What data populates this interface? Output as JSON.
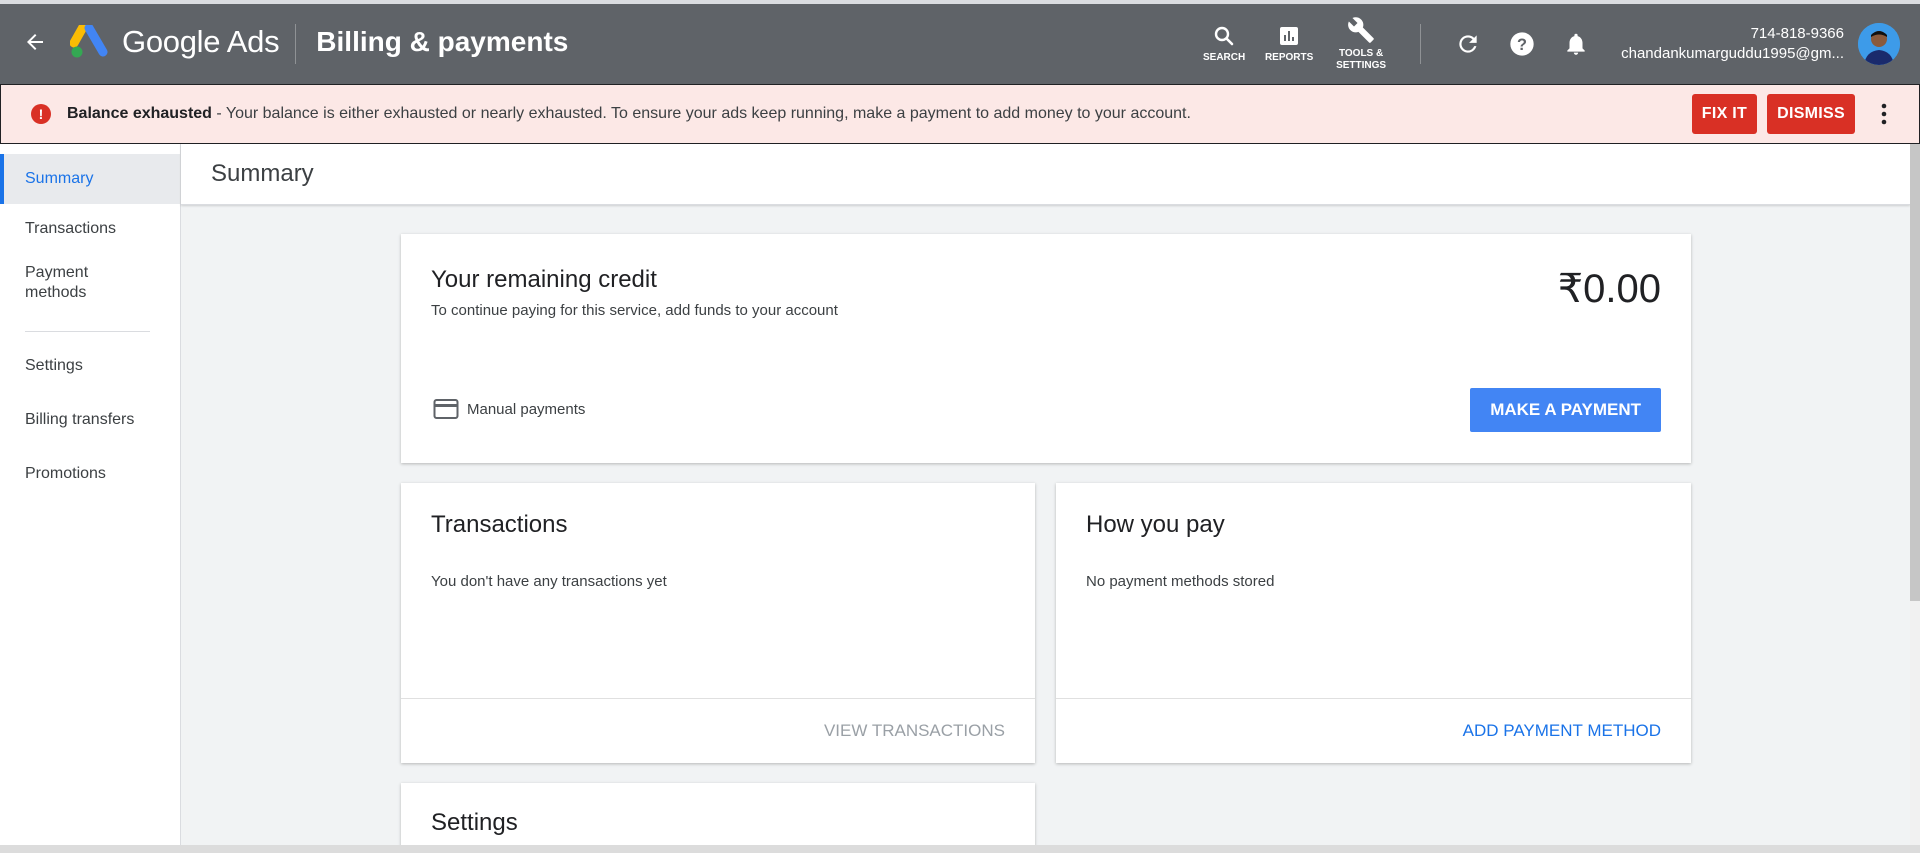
{
  "header": {
    "brand": "Google Ads",
    "page_title": "Billing & payments",
    "tools": {
      "search_label": "SEARCH",
      "reports_label": "REPORTS",
      "tools_label_line1": "TOOLS &",
      "tools_label_line2": "SETTINGS"
    },
    "account": {
      "phone": "714-818-9366",
      "email": "chandankumarguddu1995@gm..."
    }
  },
  "alert": {
    "title": "Balance exhausted",
    "message": " - Your balance is either exhausted or nearly exhausted. To ensure your ads keep running, make a payment to add money to your account.",
    "fix_label": "FIX IT",
    "dismiss_label": "DISMISS",
    "icon_glyph": "!"
  },
  "sidebar": {
    "items": [
      {
        "label": "Summary"
      },
      {
        "label": "Transactions"
      },
      {
        "label": "Payment methods"
      },
      {
        "label": "Settings"
      },
      {
        "label": "Billing transfers"
      },
      {
        "label": "Promotions"
      }
    ]
  },
  "main": {
    "title": "Summary",
    "credit": {
      "title": "Your remaining credit",
      "subtitle": "To continue paying for this service, add funds to your account",
      "amount": "₹0.00",
      "manual_label": "Manual payments",
      "button_label": "MAKE A PAYMENT"
    },
    "transactions": {
      "title": "Transactions",
      "message": "You don't have any transactions yet",
      "link_label": "VIEW TRANSACTIONS"
    },
    "how_you_pay": {
      "title": "How you pay",
      "message": "No payment methods stored",
      "link_label": "ADD PAYMENT METHOD"
    },
    "settings": {
      "title": "Settings"
    }
  },
  "colors": {
    "topbar": "#5f6368",
    "alert_bg": "#fce8e6",
    "alert_button": "#d93025",
    "primary_button": "#4285f4",
    "link_blue": "#1a73e8"
  }
}
